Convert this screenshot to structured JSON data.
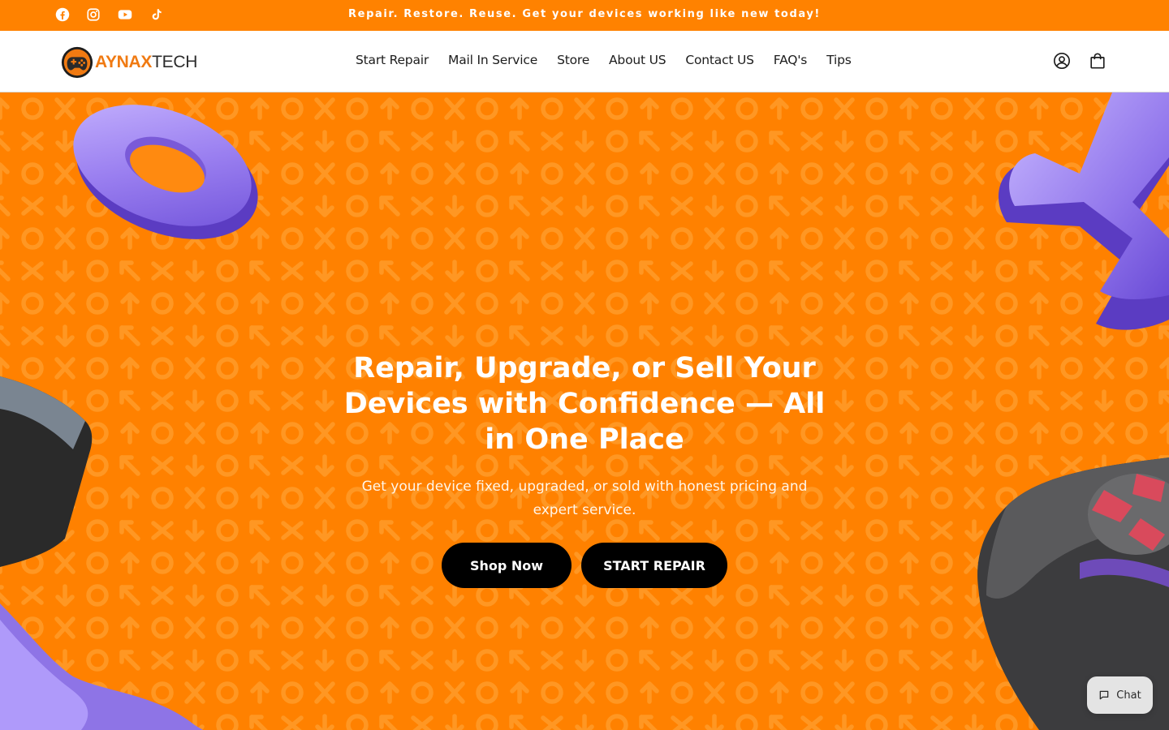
{
  "announcement": {
    "text": "Repair. Restore. Reuse. Get your devices working like new today!",
    "social_icons": [
      "facebook-icon",
      "instagram-icon",
      "youtube-icon",
      "tiktok-icon"
    ]
  },
  "header": {
    "logo_part1": "AYNAX",
    "logo_part2": "TECH",
    "nav": [
      "Start Repair",
      "Mail In Service",
      "Store",
      "About US",
      "Contact US",
      "FAQ's",
      "Tips"
    ],
    "icons": [
      "account-icon",
      "cart-icon"
    ]
  },
  "hero": {
    "title": "Repair, Upgrade, or Sell Your Devices with Confidence — All in One Place",
    "subtitle": "Get your device fixed, upgraded, or sold with honest pricing and expert service.",
    "primary_button": "Shop Now",
    "secondary_button": "START REPAIR"
  },
  "chat": {
    "label": "Chat"
  },
  "colors": {
    "brand_orange": "#ff8200",
    "pattern_orange": "#ff9a26",
    "button_black": "#000000",
    "logo_orange": "#f07a12",
    "accent_purple": "#8c78e0"
  }
}
